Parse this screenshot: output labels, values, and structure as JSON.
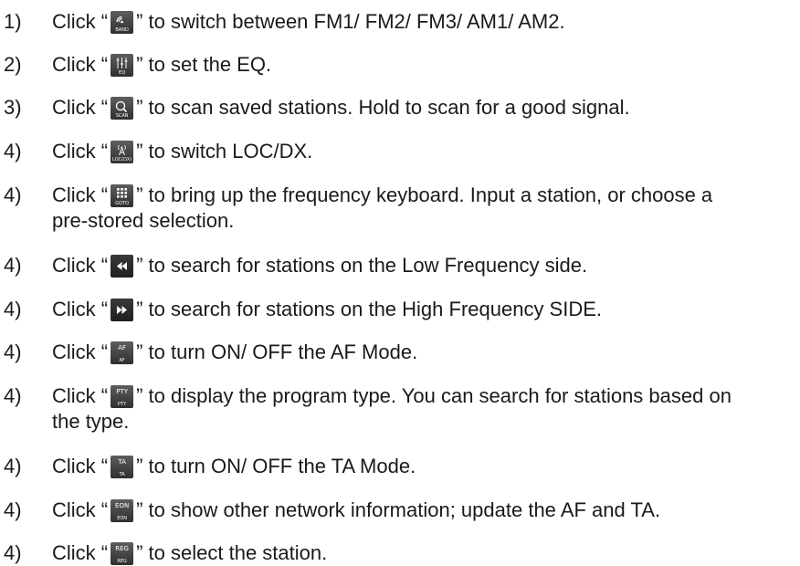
{
  "items": [
    {
      "num": "1)",
      "pre": "Click “",
      "icon": "band-icon",
      "icon_caption": "BAND",
      "post": "” to switch between FM1/ FM2/ FM3/ AM1/ AM2."
    },
    {
      "num": "2)",
      "pre": "Click “",
      "icon": "eq-icon",
      "icon_caption": "EQ",
      "post": "” to set the EQ."
    },
    {
      "num": "3)",
      "pre": "Click “",
      "icon": "scan-icon",
      "icon_caption": "SCAN",
      "post": "” to scan saved stations. Hold to scan for a good signal."
    },
    {
      "num": "4)",
      "pre": "Click “",
      "icon": "loc-dx-icon",
      "icon_caption": "LOC(DX)",
      "post": "” to switch LOC/DX."
    },
    {
      "num": "4)",
      "pre": "Click “",
      "icon": "goto-keypad-icon",
      "icon_caption": "GOTO",
      "post": "” to bring up the frequency keyboard. Input a station, or choose a",
      "post2": "pre-stored selection."
    },
    {
      "num": "4)",
      "pre": "Click “",
      "icon": "seek-back-icon",
      "icon_caption": "",
      "post": "” to search for stations on the Low Frequency side."
    },
    {
      "num": "4)",
      "pre": "Click “",
      "icon": "seek-forward-icon",
      "icon_caption": "",
      "post": "” to search for stations on the High Frequency SIDE."
    },
    {
      "num": "4)",
      "pre": "Click “",
      "icon": "af-icon",
      "icon_label": "AF",
      "icon_caption": "AF",
      "post": "” to turn ON/ OFF the AF Mode."
    },
    {
      "num": "4)",
      "pre": "Click “",
      "icon": "pty-icon",
      "icon_label": "PTY",
      "icon_caption": "PTY",
      "post": "” to display the program type. You can search for stations based on",
      "post2": "the type."
    },
    {
      "num": "4)",
      "pre": "Click “",
      "icon": "ta-icon",
      "icon_label": "TA",
      "icon_caption": "TA",
      "post": "” to turn ON/ OFF the TA Mode."
    },
    {
      "num": "4)",
      "pre": "Click “",
      "icon": "eon-icon",
      "icon_label": "EON",
      "icon_caption": "EON",
      "post": "” to show other network information; update the AF and TA."
    },
    {
      "num": "4)",
      "pre": "Click “",
      "icon": "reg-icon",
      "icon_label": "REG",
      "icon_caption": "REG",
      "post": "” to select the station."
    }
  ]
}
